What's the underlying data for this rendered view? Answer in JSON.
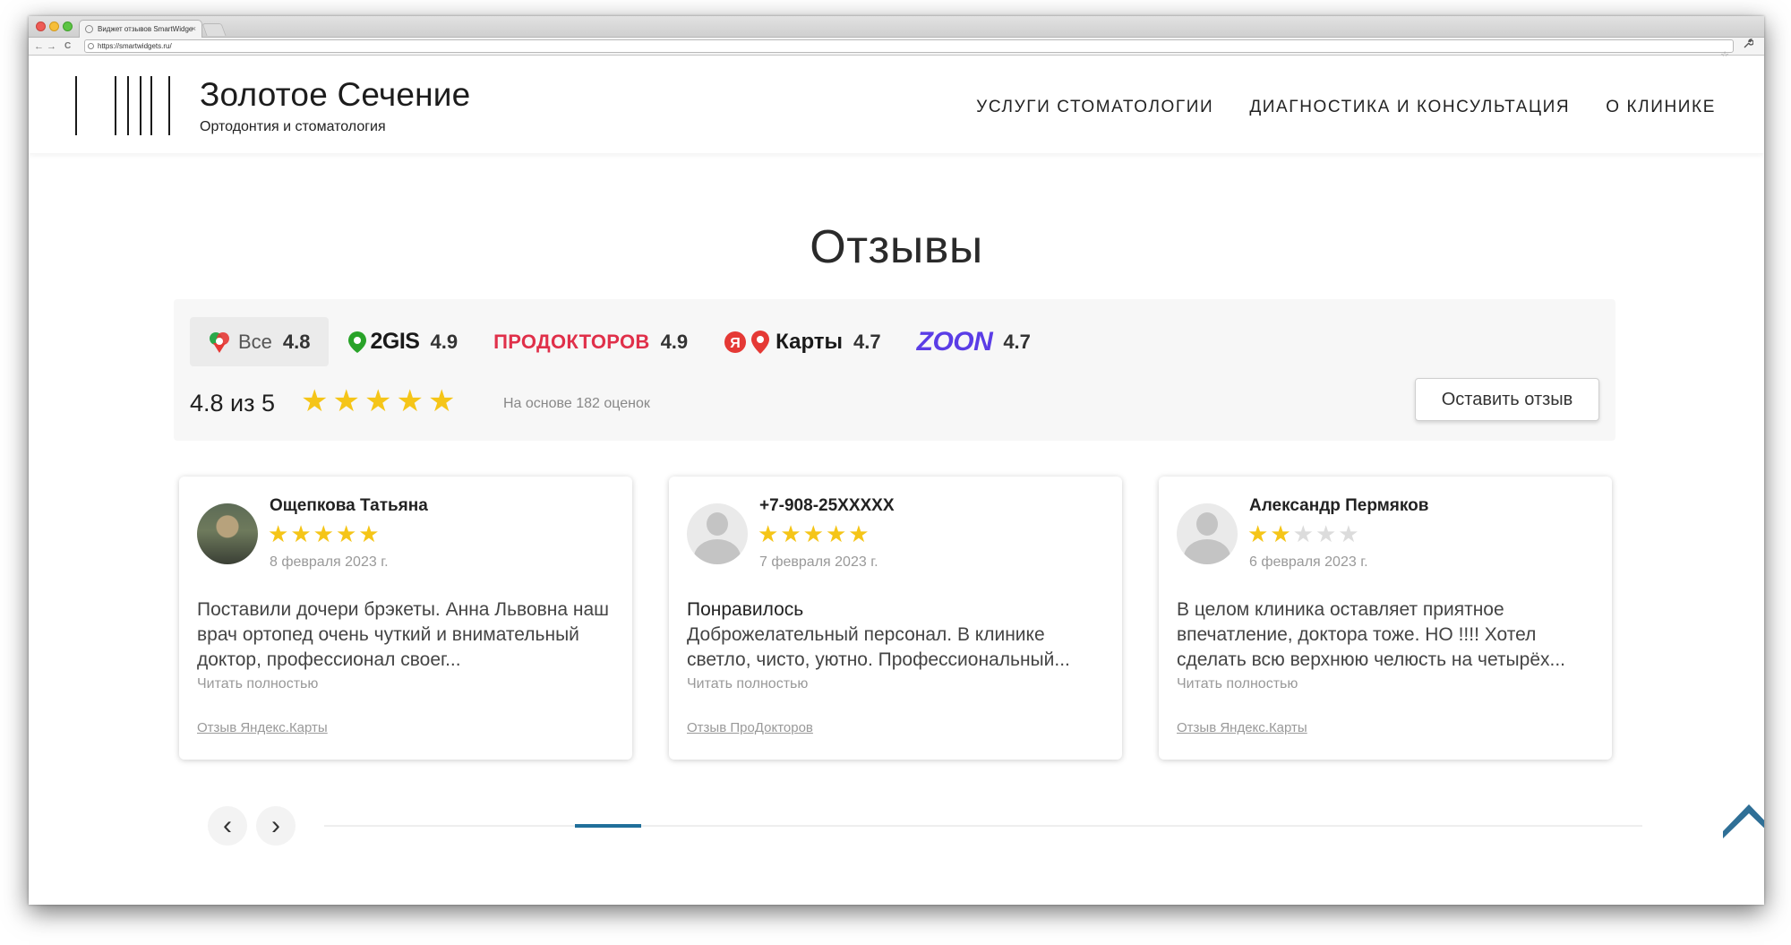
{
  "browser": {
    "tab_title": "Виджет отзывов SmartWidge",
    "tab_close": "×",
    "back": "←",
    "forward": "→",
    "reload": "C",
    "url": "https://smartwidgets.ru/",
    "bookmark": "☆",
    "wrench": "🔧"
  },
  "header": {
    "title": "Золотое Сечение",
    "subtitle": "Ортодонтия и стоматология",
    "nav": [
      "УСЛУГИ СТОМАТОЛОГИИ",
      "ДИАГНОСТИКА И КОНСУЛЬТАЦИЯ",
      "О КЛИНИКЕ"
    ]
  },
  "reviews": {
    "title": "Отзывы",
    "sources": {
      "all": {
        "label": "Все",
        "rating": "4.8"
      },
      "twogis": {
        "brand": "2GIS",
        "rating": "4.9"
      },
      "prodoctorov": {
        "brand": "ПРОДОКТОРОВ",
        "rating": "4.9"
      },
      "yandex": {
        "brand": "Карты",
        "rating": "4.7"
      },
      "zoon": {
        "brand": "ZOON",
        "rating": "4.7"
      }
    },
    "average_text": "4.8 из 5",
    "average_stars": 5,
    "based_on": "На основе 182 оценок",
    "leave_review": "Оставить отзыв",
    "cards": [
      {
        "author": "Ощепкова Татьяна",
        "stars": 5,
        "date": "8 февраля 2023 г.",
        "title": "",
        "text": "Поставили дочери брэкеты. Анна Львовна наш врач ортопед очень чуткий и внимательный доктор, профессионал своег...",
        "read_more": "Читать полностью",
        "source": "Отзыв Яндекс.Карты"
      },
      {
        "author": "+7-908-25XXXXX",
        "stars": 5,
        "date": "7 февраля 2023 г.",
        "title": "Понравилось",
        "text": "Доброжелательный персонал. В клинике светло, чисто, уютно. Профессиональный...",
        "read_more": "Читать полностью",
        "source": "Отзыв ПроДокторов"
      },
      {
        "author": "Александр Пермяков",
        "stars": 2,
        "date": "6 февраля 2023 г.",
        "title": "",
        "text": "В целом клиника оставляет приятное впечатление, доктора тоже. НО !!!! Хотел сделать всю верхнюю челюсть на четырёх...",
        "read_more": "Читать полностью",
        "source": "Отзыв Яндекс.Карты"
      }
    ],
    "pager": {
      "prev": "‹",
      "next": "›",
      "position": 0.2
    }
  },
  "colors": {
    "star": "#f5c518",
    "star_off": "#dcdcdc",
    "accent": "#1f6f9a",
    "scroll_top": "#2f6f96",
    "zoon": "#5a3de6",
    "prodoctorov_red": "#e0304a",
    "prodoctorov_blue": "#2a63c9",
    "twogis_green": "#29a329"
  }
}
